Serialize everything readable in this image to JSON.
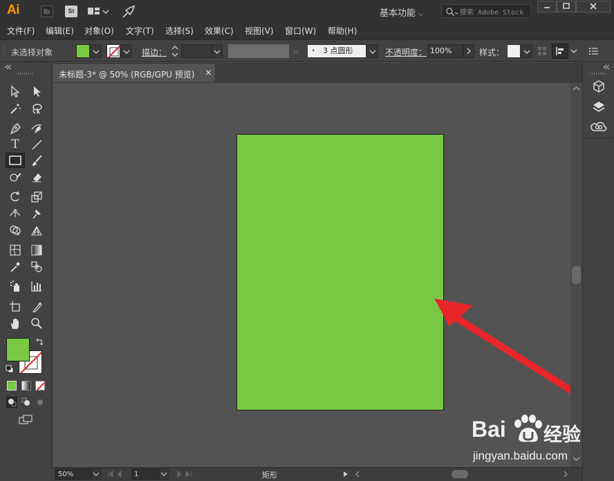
{
  "titlebar": {
    "logo": "Ai",
    "bridge": "Br",
    "stock": "St",
    "workspace": "基本功能",
    "search_placeholder": "搜索 Adobe Stock"
  },
  "menu": [
    "文件(F)",
    "编辑(E)",
    "对象(O)",
    "文字(T)",
    "选择(S)",
    "效果(C)",
    "视图(V)",
    "窗口(W)",
    "帮助(H)"
  ],
  "control": {
    "selection": "未选择对象",
    "stroke_label": "描边：",
    "brush": "3 点圆形",
    "opacity_label": "不透明度：",
    "opacity_value": "100%",
    "style_label": "样式："
  },
  "document": {
    "tab_title": "未标题-3* @ 50% (RGB/GPU 预览)",
    "close": "×"
  },
  "status": {
    "zoom": "50%",
    "page": "1",
    "tool_name": "矩形"
  },
  "watermark": {
    "brand": "Bai",
    "brand2": "经验",
    "url": "jingyan.baidu.com"
  },
  "colors": {
    "fill": "#78c844",
    "accent": "#ff9a00",
    "arrow": "#e8262a"
  }
}
